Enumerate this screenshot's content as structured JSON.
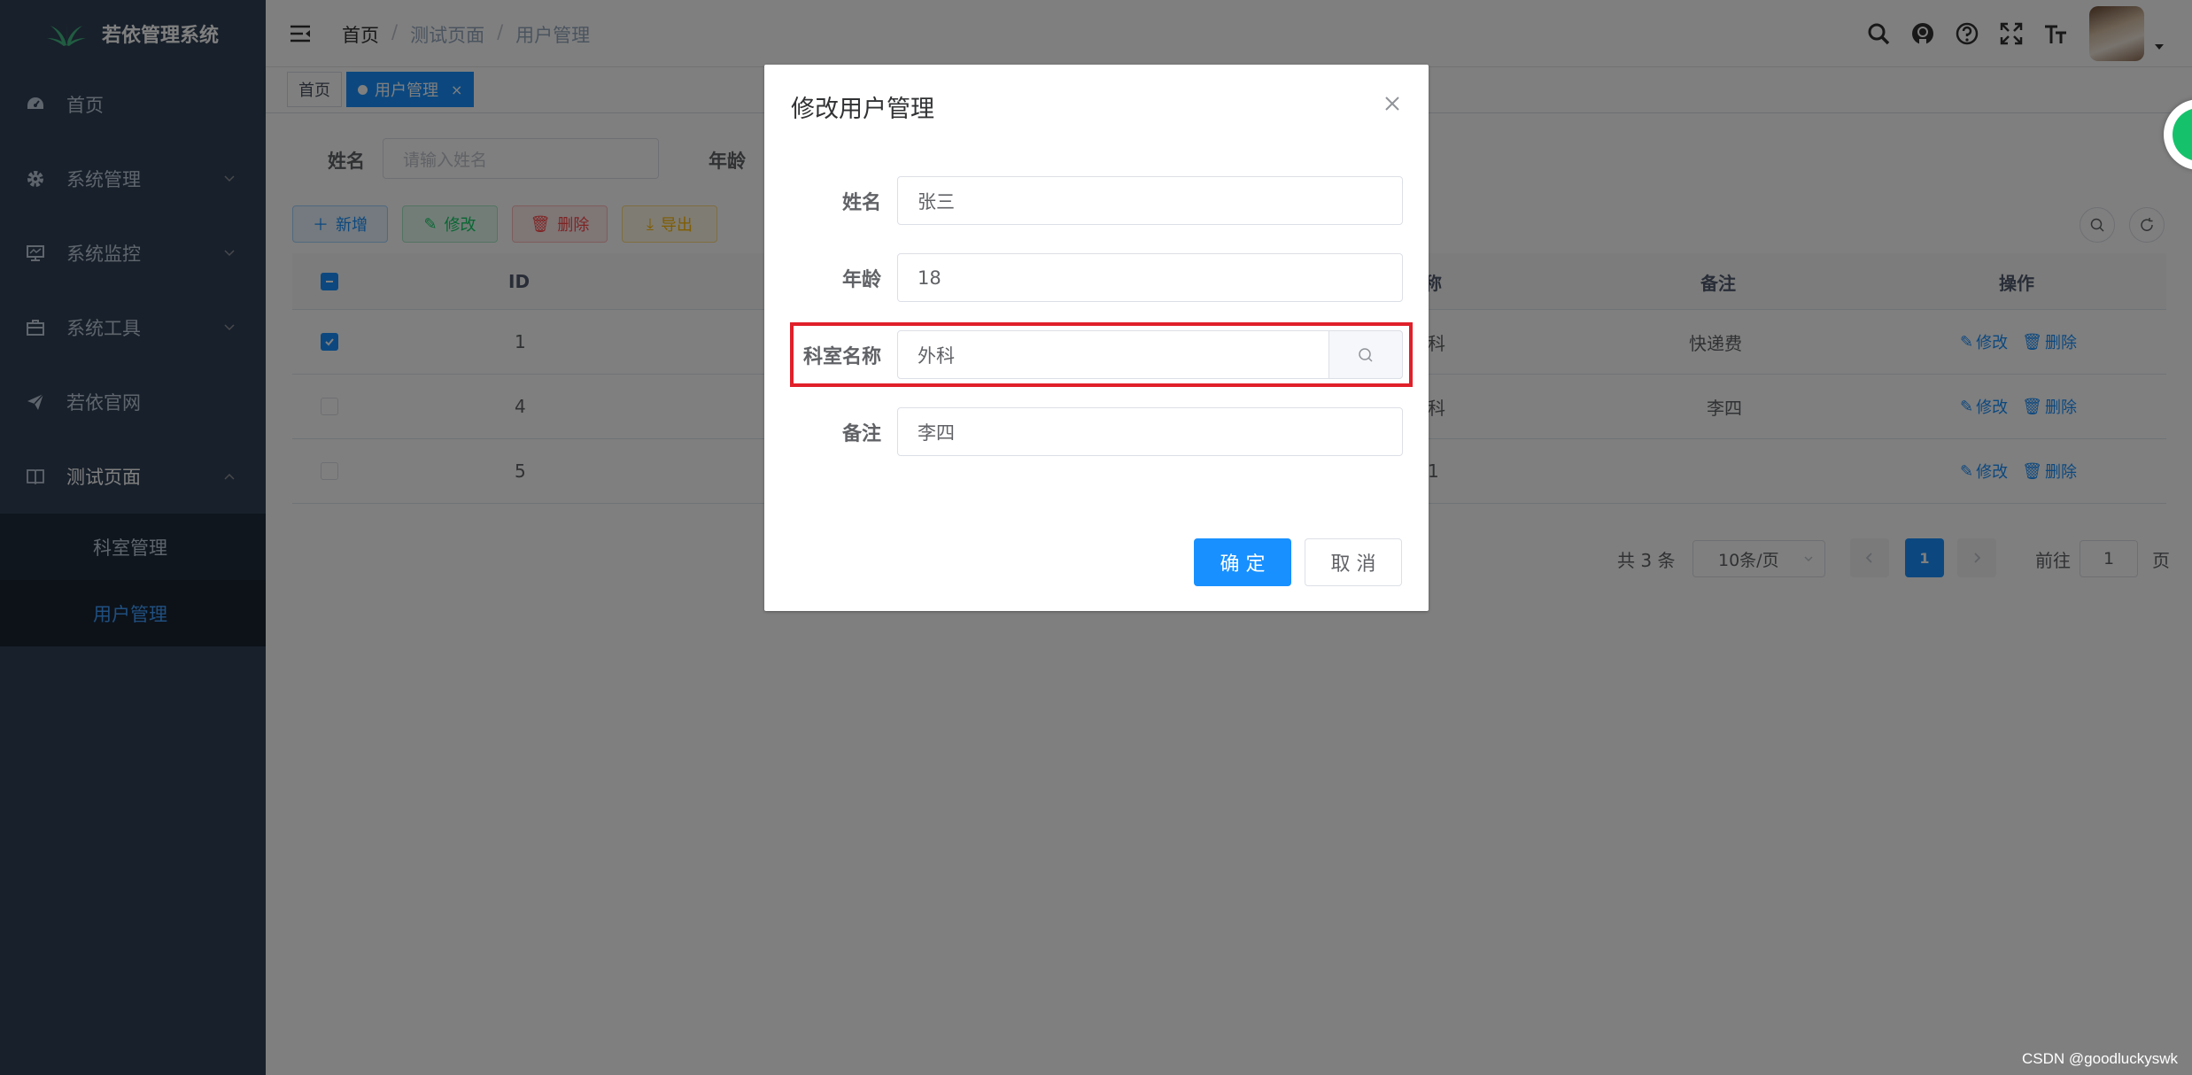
{
  "app": {
    "title": "若依管理系统"
  },
  "sidebar": {
    "items": [
      {
        "label": "首页",
        "icon": "dashboard-icon"
      },
      {
        "label": "系统管理",
        "icon": "gear-icon"
      },
      {
        "label": "系统监控",
        "icon": "monitor-icon"
      },
      {
        "label": "系统工具",
        "icon": "toolbox-icon"
      },
      {
        "label": "若依官网",
        "icon": "send-icon"
      },
      {
        "label": "测试页面",
        "icon": "book-icon"
      }
    ],
    "submenu": [
      {
        "label": "科室管理"
      },
      {
        "label": "用户管理"
      }
    ]
  },
  "breadcrumb": {
    "home": "首页",
    "sep": "/",
    "level1": "测试页面",
    "level2": "用户管理"
  },
  "tags": {
    "home": "首页",
    "active": "用户管理",
    "close": "×"
  },
  "query": {
    "name_label": "姓名",
    "name_placeholder": "请输入姓名",
    "age_label": "年龄"
  },
  "toolbar": {
    "add": "新增",
    "edit": "修改",
    "delete": "删除",
    "export": "导出"
  },
  "table": {
    "columns": {
      "id": "ID",
      "dept": "称",
      "remark": "备注",
      "ops": "操作"
    },
    "rows": [
      {
        "id": "1",
        "dept": "科",
        "remark": "快递费",
        "checked": true
      },
      {
        "id": "4",
        "dept": "科",
        "remark": "李四",
        "checked": false
      },
      {
        "id": "5",
        "dept": "1",
        "remark": "",
        "checked": false
      }
    ],
    "op_edit": "修改",
    "op_delete": "删除"
  },
  "pagination": {
    "total": "共 3 条",
    "page_size": "10条/页",
    "current": "1",
    "goto_prefix": "前往",
    "goto_value": "1",
    "goto_suffix": "页"
  },
  "dialog": {
    "title": "修改用户管理",
    "fields": {
      "name_label": "姓名",
      "name_value": "张三",
      "age_label": "年龄",
      "age_value": "18",
      "dept_label": "科室名称",
      "dept_value": "外科",
      "remark_label": "备注",
      "remark_value": "李四"
    },
    "ok": "确 定",
    "cancel": "取 消"
  },
  "colors": {
    "primary": "#1890ff",
    "sidebar": "#304156",
    "highlight": "#e0202a"
  },
  "watermark": "CSDN @goodluckyswk"
}
